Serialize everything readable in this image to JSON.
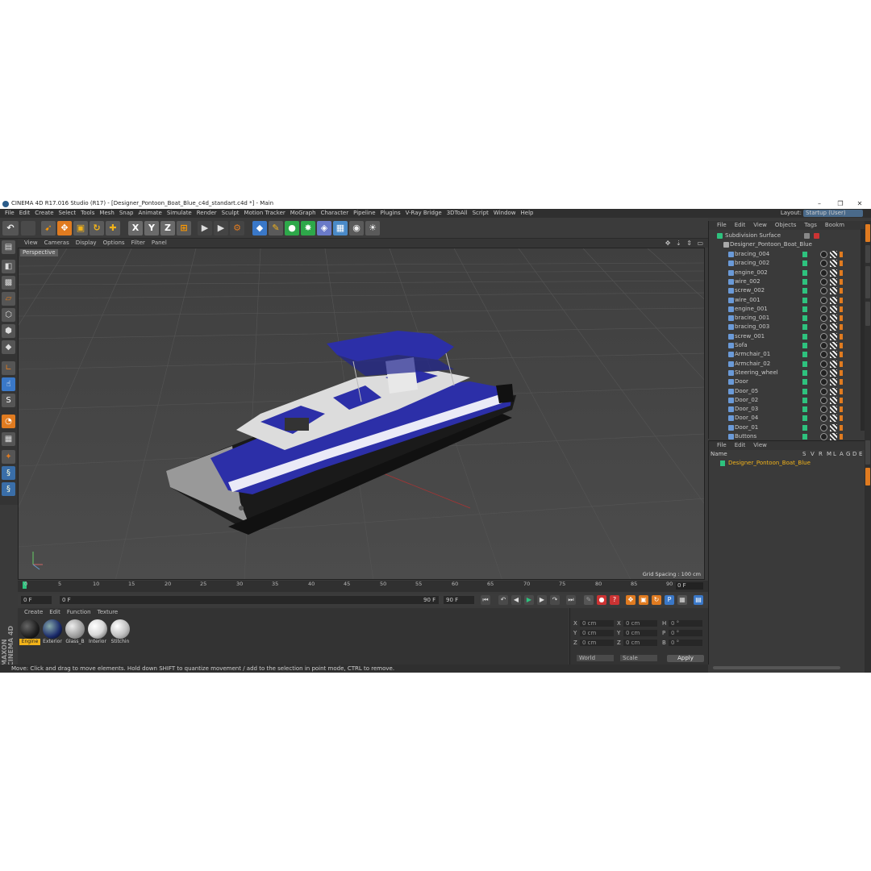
{
  "window": {
    "title": "CINEMA 4D R17.016 Studio (R17) - [Designer_Pontoon_Boat_Blue_c4d_standart.c4d *] - Main",
    "minimize": "–",
    "maximize": "❐",
    "close": "✕"
  },
  "menubar": {
    "items": [
      "File",
      "Edit",
      "Create",
      "Select",
      "Tools",
      "Mesh",
      "Snap",
      "Animate",
      "Simulate",
      "Render",
      "Sculpt",
      "Motion Tracker",
      "MoGraph",
      "Character",
      "Pipeline",
      "Plugins",
      "V-Ray Bridge",
      "3DToAll",
      "Script",
      "Window",
      "Help"
    ],
    "layout_label": "Layout:",
    "layout_value": "Startup (User)"
  },
  "toolbar": {
    "undo": "↶",
    "x_axis": "X",
    "y_axis": "Y",
    "z_axis": "Z"
  },
  "viewport": {
    "menu": [
      "View",
      "Cameras",
      "Display",
      "Options",
      "Filter",
      "Panel"
    ],
    "label": "Perspective",
    "grid_spacing": "Grid Spacing : 100 cm",
    "nav_icons": "✥ ⇣ ⇕ ▭"
  },
  "timeline": {
    "ticks": [
      "0",
      "5",
      "10",
      "15",
      "20",
      "25",
      "30",
      "35",
      "40",
      "45",
      "50",
      "55",
      "60",
      "65",
      "70",
      "75",
      "80",
      "85",
      "90"
    ],
    "current_frame": "0 F"
  },
  "transport": {
    "start": "0 F",
    "min": "0 F",
    "max_inner": "90 F",
    "end": "90 F"
  },
  "materials": {
    "menu": [
      "Create",
      "Edit",
      "Function",
      "Texture"
    ],
    "items": [
      {
        "label": "Engine",
        "color": "#1e1e1e",
        "selected": true
      },
      {
        "label": "Exterior",
        "color": "#1a2a6a",
        "selected": false
      },
      {
        "label": "Glass_B",
        "color": "#9a9a9a",
        "selected": false
      },
      {
        "label": "Interior",
        "color": "#d8d8d8",
        "selected": false
      },
      {
        "label": "Stitchin",
        "color": "#c0c0c0",
        "selected": false
      }
    ],
    "brand_line1": "MAXON",
    "brand_line2": "CINEMA 4D"
  },
  "coordinates": {
    "rows": [
      {
        "a": "X",
        "av": "0 cm",
        "b": "X",
        "bv": "0 cm",
        "c": "H",
        "cv": "0 °"
      },
      {
        "a": "Y",
        "av": "0 cm",
        "b": "Y",
        "bv": "0 cm",
        "c": "P",
        "cv": "0 °"
      },
      {
        "a": "Z",
        "av": "0 cm",
        "b": "Z",
        "bv": "0 cm",
        "c": "B",
        "cv": "0 °"
      }
    ],
    "mode1": "World",
    "mode2": "Scale",
    "apply": "Apply"
  },
  "status": "Move: Click and drag to move elements. Hold down SHIFT to quantize movement / add to the selection in point mode, CTRL to remove.",
  "object_manager": {
    "menu": [
      "File",
      "Edit",
      "View",
      "Objects",
      "Tags",
      "Bookm"
    ],
    "root": "Subdivision Surface",
    "group": "Designer_Pontoon_Boat_Blue",
    "objects": [
      "bracing_004",
      "bracing_002",
      "engine_002",
      "wire_002",
      "screw_002",
      "wire_001",
      "engine_001",
      "bracing_001",
      "bracing_003",
      "screw_001",
      "Sofa",
      "Armchair_01",
      "Armchair_02",
      "Steering_wheel",
      "Door",
      "Door_05",
      "Door_02",
      "Door_03",
      "Door_04",
      "Door_01",
      "Buttons"
    ]
  },
  "attribute_manager": {
    "menu": [
      "File",
      "Edit",
      "View"
    ],
    "col_name": "Name",
    "cols": [
      "S",
      "V",
      "R",
      "M",
      "L",
      "A",
      "G",
      "D",
      "E",
      "X"
    ],
    "selected_object": "Designer_Pontoon_Boat_Blue"
  },
  "colors": {
    "accent_orange": "#e07b20",
    "boat_blue": "#2c2fa8",
    "layer_green": "#2ec27e",
    "selection_yellow": "#f2b31a"
  }
}
